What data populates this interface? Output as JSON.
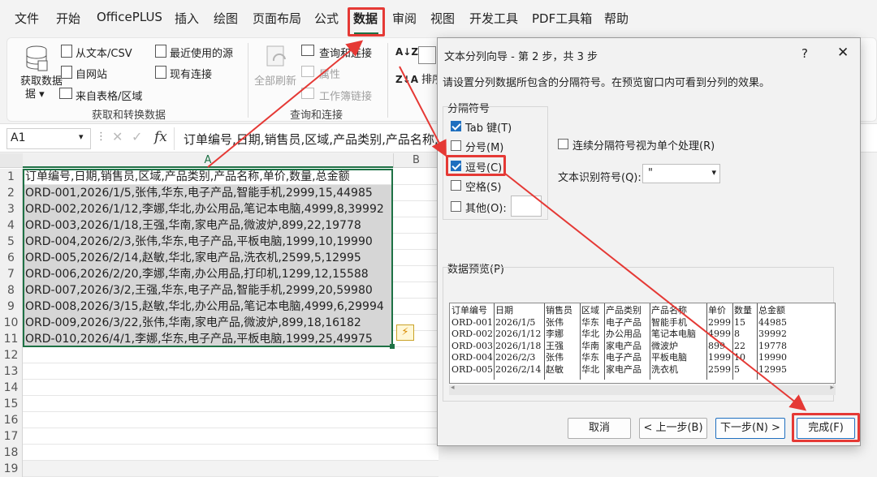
{
  "menu": {
    "items": [
      "文件",
      "开始",
      "OfficePLUS",
      "插入",
      "绘图",
      "页面布局",
      "公式",
      "数据",
      "审阅",
      "视图",
      "开发工具",
      "PDF工具箱",
      "帮助"
    ],
    "active": "数据"
  },
  "ribbon": {
    "get_data_label": "获取数据",
    "get_data_arrow": "据 ▾",
    "from_text_csv": "从文本/CSV",
    "from_web": "自网站",
    "from_table": "来自表格/区域",
    "recent_sources": "最近使用的源",
    "existing_connections": "现有连接",
    "group1_label": "获取和转换数据",
    "refresh_all": "全部刷新",
    "queries_connections": "查询和连接",
    "properties": "属性",
    "workbook_links": "工作簿链接",
    "group2_label": "查询和连接",
    "sort": "排序"
  },
  "formula_bar": {
    "name_box": "A1",
    "fx": "fx",
    "content": "订单编号,日期,销售员,区域,产品类别,产品名称,单"
  },
  "grid": {
    "col_a": "A",
    "col_b": "B",
    "row_numbers": [
      "1",
      "2",
      "3",
      "4",
      "5",
      "6",
      "7",
      "8",
      "9",
      "10",
      "11",
      "12",
      "13",
      "14",
      "15",
      "16",
      "17",
      "18",
      "19"
    ],
    "rows": [
      "订单编号,日期,销售员,区域,产品类别,产品名称,单价,数量,总金额",
      "ORD-001,2026/1/5,张伟,华东,电子产品,智能手机,2999,15,44985",
      "ORD-002,2026/1/12,李娜,华北,办公用品,笔记本电脑,4999,8,39992",
      "ORD-003,2026/1/18,王强,华南,家电产品,微波炉,899,22,19778",
      "ORD-004,2026/2/3,张伟,华东,电子产品,平板电脑,1999,10,19990",
      "ORD-005,2026/2/14,赵敏,华北,家电产品,洗衣机,2599,5,12995",
      "ORD-006,2026/2/20,李娜,华南,办公用品,打印机,1299,12,15588",
      "ORD-007,2026/3/2,王强,华东,电子产品,智能手机,2999,20,59980",
      "ORD-008,2026/3/15,赵敏,华北,办公用品,笔记本电脑,4999,6,29994",
      "ORD-009,2026/3/22,张伟,华南,家电产品,微波炉,899,18,16182",
      "ORD-010,2026/4/1,李娜,华东,电子产品,平板电脑,1999,25,49975"
    ]
  },
  "dialog": {
    "title": "文本分列向导 - 第 2 步，共 3 步",
    "help": "?",
    "close": "✕",
    "description": "请设置分列数据所包含的分隔符号。在预览窗口内可看到分列的效果。",
    "delimiters_label": "分隔符号",
    "tab": "Tab 键(T)",
    "semicolon": "分号(M)",
    "comma": "逗号(C)",
    "space": "空格(S)",
    "other": "其他(O):",
    "consecutive": "连续分隔符号视为单个处理(R)",
    "text_qualifier_label": "文本识别符号(Q):",
    "text_qualifier_value": "\"",
    "preview_label": "数据预览(P)",
    "preview_headers": [
      "订单编号",
      "日期",
      "销售员",
      "区域",
      "产品类别",
      "产品名称",
      "单价",
      "数量",
      "总金额"
    ],
    "preview_rows": [
      [
        "ORD-001",
        "2026/1/5",
        "张伟",
        "华东",
        "电子产品",
        "智能手机",
        "2999",
        "15",
        "44985"
      ],
      [
        "ORD-002",
        "2026/1/12",
        "李娜",
        "华北",
        "办公用品",
        "笔记本电脑",
        "4999",
        "8",
        "39992"
      ],
      [
        "ORD-003",
        "2026/1/18",
        "王强",
        "华南",
        "家电产品",
        "微波炉",
        "899",
        "22",
        "19778"
      ],
      [
        "ORD-004",
        "2026/2/3",
        "张伟",
        "华东",
        "电子产品",
        "平板电脑",
        "1999",
        "10",
        "19990"
      ],
      [
        "ORD-005",
        "2026/2/14",
        "赵敏",
        "华北",
        "家电产品",
        "洗衣机",
        "2599",
        "5",
        "12995"
      ]
    ],
    "cancel": "取消",
    "back": "< 上一步(B)",
    "next": "下一步(N) >",
    "finish": "完成(F)"
  }
}
